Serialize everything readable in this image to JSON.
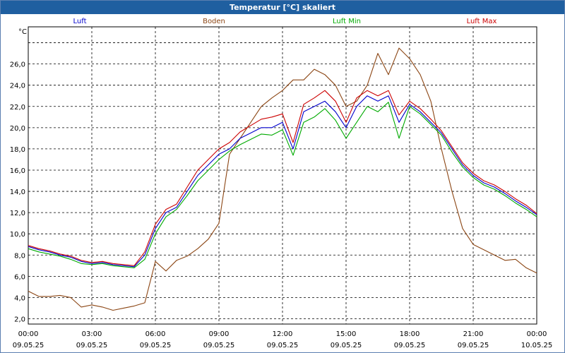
{
  "window": {
    "title": "Temperatur [°C] skaliert"
  },
  "chart_data": {
    "type": "line",
    "title": "Temperatur [°C] skaliert",
    "ylabel": "°C",
    "ylim": [
      1.5,
      29.5
    ],
    "xlim": [
      "2025-05-09T00:00",
      "2025-05-10T00:00"
    ],
    "grid": true,
    "legend_position": "top",
    "y_ticks": [
      "2,0",
      "4,0",
      "6,0",
      "8,0",
      "10,0",
      "12,0",
      "14,0",
      "16,0",
      "18,0",
      "20,0",
      "22,0",
      "24,0",
      "26,0"
    ],
    "y_tick_values": [
      2,
      4,
      6,
      8,
      10,
      12,
      14,
      16,
      18,
      20,
      22,
      24,
      26
    ],
    "x_ticks": [
      {
        "time": "00:00",
        "date": "09.05.25"
      },
      {
        "time": "03:00",
        "date": "09.05.25"
      },
      {
        "time": "06:00",
        "date": "09.05.25"
      },
      {
        "time": "09:00",
        "date": "09.05.25"
      },
      {
        "time": "12:00",
        "date": "09.05.25"
      },
      {
        "time": "15:00",
        "date": "09.05.25"
      },
      {
        "time": "18:00",
        "date": "09.05.25"
      },
      {
        "time": "21:00",
        "date": "09.05.25"
      },
      {
        "time": "00:00",
        "date": "10.05.25"
      }
    ],
    "x_hours": [
      0,
      0.5,
      1,
      1.5,
      2,
      2.5,
      3,
      3.5,
      4,
      4.5,
      5,
      5.5,
      6,
      6.5,
      7,
      7.5,
      8,
      8.5,
      9,
      9.5,
      10,
      10.5,
      11,
      11.5,
      12,
      12.5,
      13,
      13.5,
      14,
      14.5,
      15,
      15.5,
      16,
      16.5,
      17,
      17.5,
      18,
      18.5,
      19,
      19.5,
      20,
      20.5,
      21,
      21.5,
      22,
      22.5,
      23,
      23.5,
      24
    ],
    "series": [
      {
        "name": "Luft",
        "color": "#0000cc",
        "values": [
          8.8,
          8.5,
          8.3,
          8.0,
          7.8,
          7.4,
          7.2,
          7.3,
          7.1,
          7.0,
          6.9,
          8.0,
          10.5,
          12.0,
          12.5,
          14.0,
          15.5,
          16.5,
          17.5,
          18.0,
          19.0,
          19.5,
          20.0,
          20.0,
          20.5,
          18.0,
          21.5,
          22.0,
          22.5,
          21.5,
          20.0,
          22.0,
          23.0,
          22.5,
          23.0,
          20.5,
          22.2,
          21.5,
          20.5,
          19.5,
          18.0,
          16.5,
          15.5,
          14.8,
          14.4,
          13.8,
          13.1,
          12.5,
          11.8
        ]
      },
      {
        "name": "Boden",
        "color": "#8b4513",
        "values": [
          4.6,
          4.1,
          4.1,
          4.2,
          4.0,
          3.1,
          3.3,
          3.1,
          2.8,
          3.0,
          3.2,
          3.5,
          7.4,
          6.5,
          7.5,
          7.9,
          8.6,
          9.5,
          11.0,
          17.5,
          19.0,
          20.5,
          22.0,
          22.8,
          23.5,
          24.5,
          24.5,
          25.5,
          25.0,
          24.0,
          22.0,
          22.5,
          24.0,
          27.0,
          25.0,
          27.5,
          26.5,
          25.0,
          22.5,
          18.0,
          14.0,
          10.5,
          9.0,
          8.5,
          8.0,
          7.5,
          7.6,
          6.8,
          6.3
        ]
      },
      {
        "name": "Luft Min",
        "color": "#00aa00",
        "values": [
          8.6,
          8.3,
          8.1,
          7.9,
          7.6,
          7.2,
          7.1,
          7.2,
          7.0,
          6.9,
          6.8,
          7.6,
          10.0,
          11.6,
          12.3,
          13.6,
          15.0,
          16.0,
          17.0,
          17.8,
          18.4,
          18.9,
          19.4,
          19.3,
          19.8,
          17.4,
          20.5,
          21.0,
          21.8,
          20.7,
          19.0,
          20.5,
          22.0,
          21.5,
          22.4,
          19.0,
          22.0,
          21.3,
          20.3,
          19.3,
          17.7,
          16.3,
          15.3,
          14.6,
          14.2,
          13.6,
          12.9,
          12.3,
          11.6
        ]
      },
      {
        "name": "Luft Max",
        "color": "#cc0000",
        "values": [
          8.9,
          8.6,
          8.4,
          8.1,
          7.9,
          7.5,
          7.3,
          7.4,
          7.2,
          7.1,
          7.0,
          8.3,
          10.9,
          12.3,
          12.8,
          14.4,
          16.0,
          17.0,
          18.0,
          18.6,
          19.6,
          20.2,
          20.8,
          21.0,
          21.3,
          18.6,
          22.2,
          22.8,
          23.5,
          22.5,
          20.5,
          22.8,
          23.5,
          23.0,
          23.5,
          21.2,
          22.5,
          21.8,
          20.8,
          19.7,
          18.2,
          16.7,
          15.7,
          15.0,
          14.6,
          14.0,
          13.3,
          12.7,
          11.9
        ]
      }
    ]
  }
}
